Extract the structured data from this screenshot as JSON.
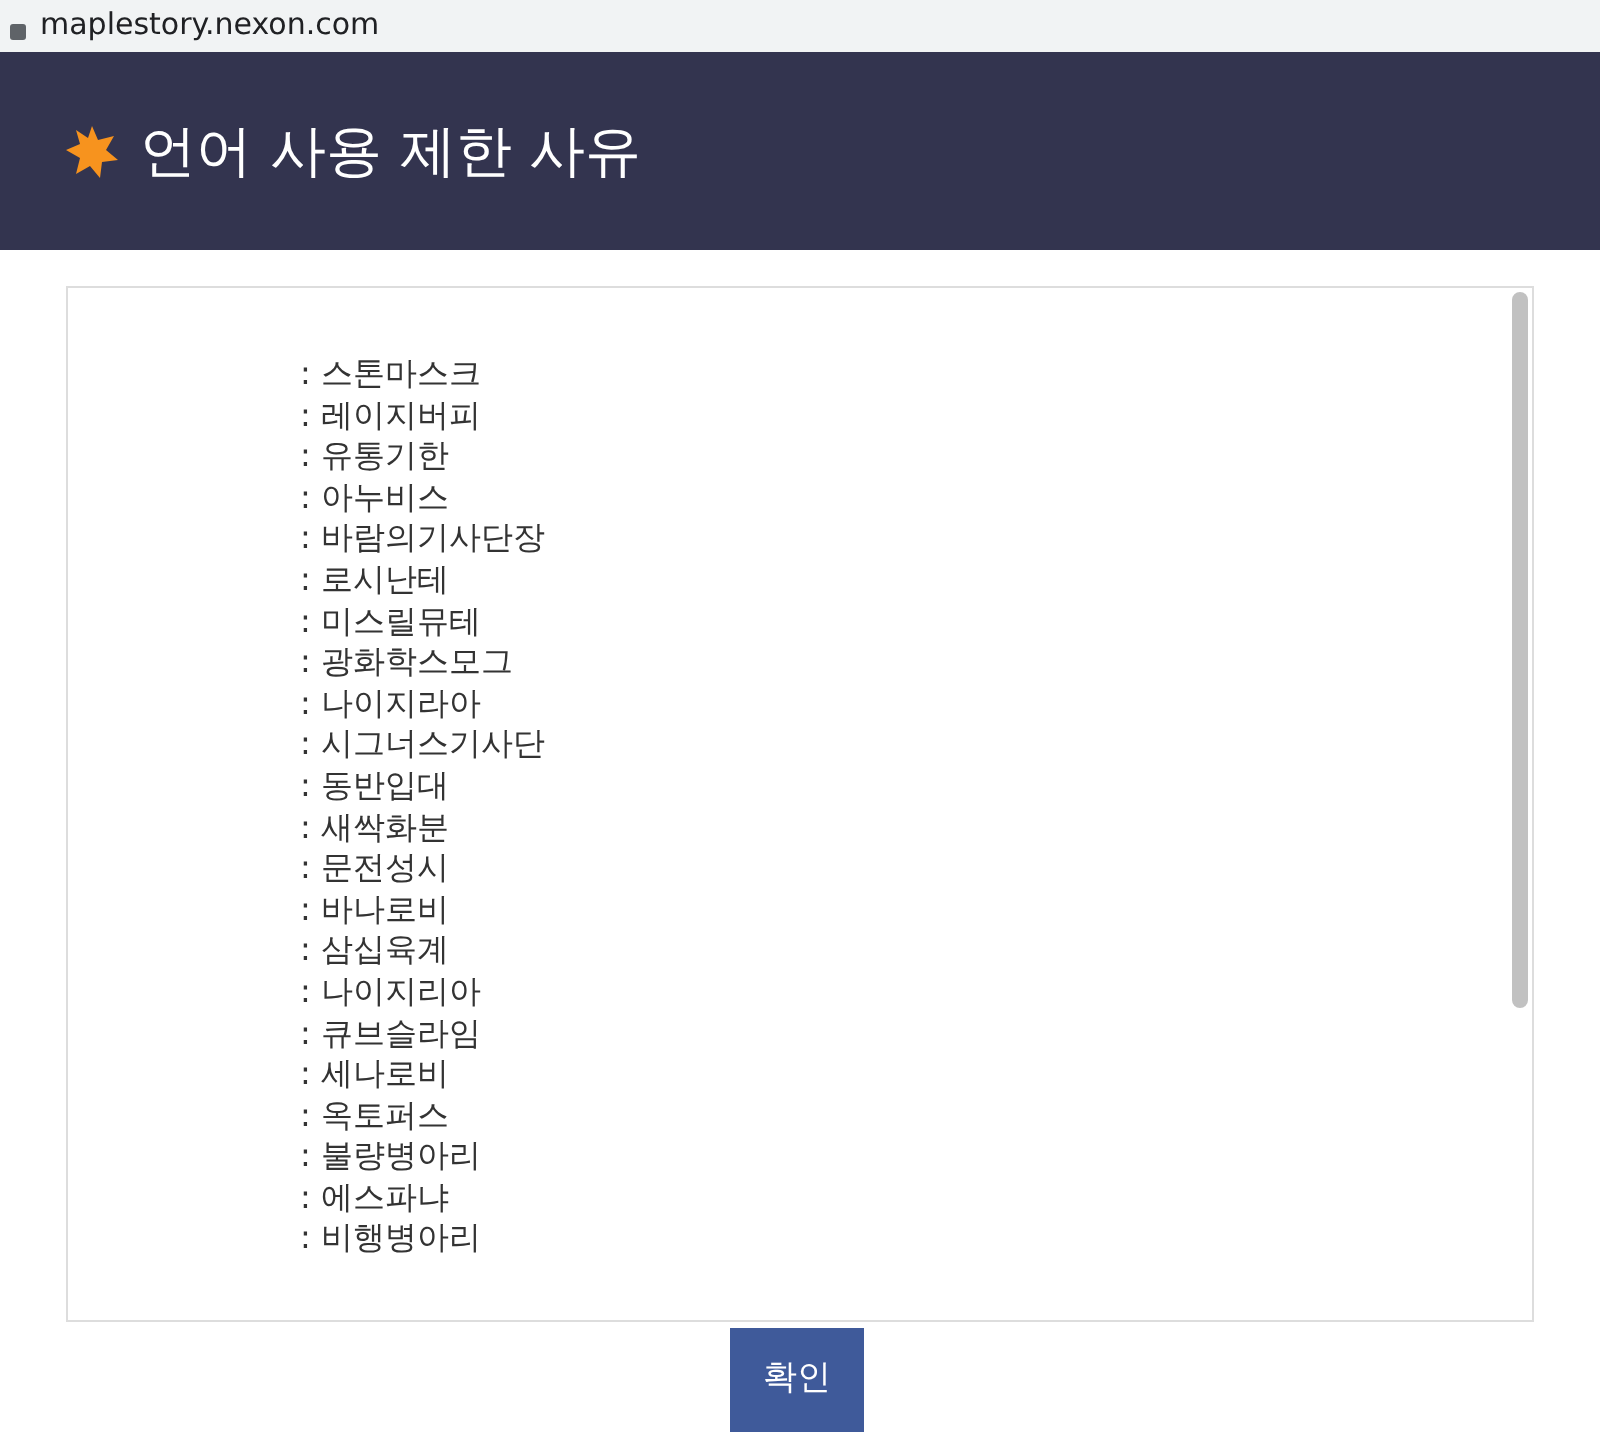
{
  "browser": {
    "url": "maplestory.nexon.com"
  },
  "header": {
    "title": "언어 사용 제한 사유"
  },
  "reasons": [
    ": 스톤마스크",
    ": 레이지버피",
    ": 유통기한",
    ": 아누비스",
    ": 바람의기사단장",
    ": 로시난테",
    ": 미스릴뮤테",
    ": 광화학스모그",
    ": 나이지라아",
    ": 시그너스기사단",
    ": 동반입대",
    ": 새싹화분",
    ": 문전성시",
    ": 바나로비",
    ": 삼십육계",
    ": 나이지리아",
    ": 큐브슬라임",
    ": 세나로비",
    ": 옥토퍼스",
    ": 불량병아리",
    ": 에스파냐",
    ": 비행병아리"
  ],
  "buttons": [
    "확인"
  ]
}
